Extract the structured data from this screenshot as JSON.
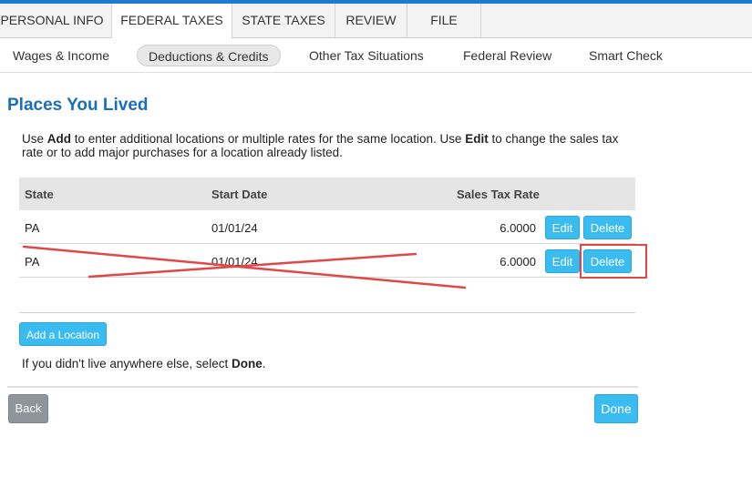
{
  "tabs": [
    {
      "label": "PERSONAL INFO"
    },
    {
      "label": "FEDERAL TAXES"
    },
    {
      "label": "STATE TAXES"
    },
    {
      "label": "REVIEW"
    },
    {
      "label": "FILE"
    }
  ],
  "subnav": {
    "wages": "Wages & Income",
    "deductions": "Deductions & Credits",
    "other": "Other Tax Situations",
    "federal_review": "Federal Review",
    "smart_check": "Smart Check"
  },
  "page": {
    "title": "Places You Lived",
    "instructions": {
      "part1": "Use ",
      "add_word": "Add",
      "part2": " to enter additional locations or multiple rates for the same location. Use ",
      "edit_word": "Edit",
      "part3": " to change the sales tax rate or to add major purchases for a location already listed."
    }
  },
  "table": {
    "headers": {
      "state": "State",
      "start_date": "Start Date",
      "rate": "Sales Tax Rate"
    },
    "rows": [
      {
        "state": "PA",
        "start_date": "01/01/24",
        "rate": "6.0000",
        "edit": "Edit",
        "delete": "Delete"
      },
      {
        "state": "PA",
        "start_date": "01/01/24",
        "rate": "6.0000",
        "edit": "Edit",
        "delete": "Delete"
      }
    ]
  },
  "actions": {
    "add_location": "Add a Location",
    "note_part1": "If you didn't live anywhere else, select ",
    "note_done": "Done",
    "note_part2": ".",
    "back": "Back",
    "done": "Done"
  },
  "colors": {
    "accent": "#3bbcf1",
    "title": "#1a6fb8",
    "annotation": "#e04848"
  }
}
